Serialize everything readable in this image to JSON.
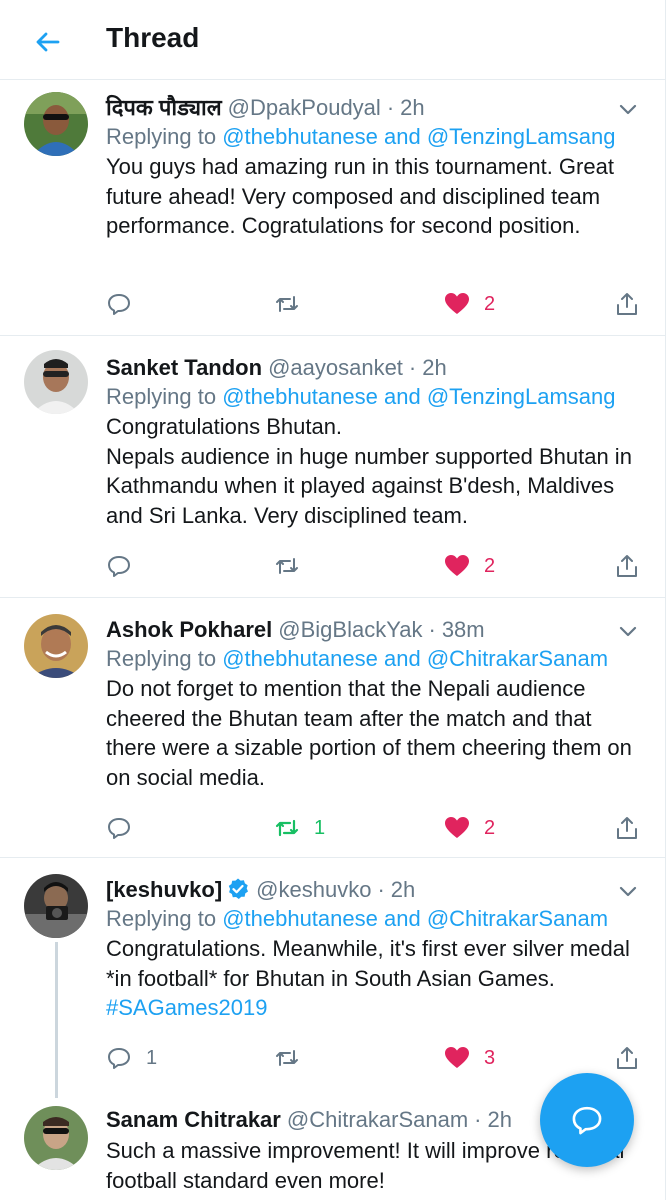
{
  "header": {
    "title": "Thread"
  },
  "tweets": [
    {
      "display_name": "दिपक पौड्याल",
      "handle": "@DpakPoudyal",
      "time": "2h",
      "replying_prefix": "Replying to ",
      "replying_to_1": "@thebhutanese",
      "replying_and": " and ",
      "replying_to_2": "@TenzingLamsang",
      "text": "You guys had amazing run in this tournament. Great future ahead! Very composed and disciplined team performance. Cogratulations for second position.",
      "reply_count": "",
      "retweet_count": "",
      "like_count": "2"
    },
    {
      "display_name": "Sanket Tandon",
      "handle": "@aayosanket",
      "time": "2h",
      "replying_prefix": "Replying to ",
      "replying_to_1": "@thebhutanese",
      "replying_and": " and ",
      "replying_to_2": "@TenzingLamsang",
      "text": "Congratulations Bhutan.\nNepals audience in huge number supported Bhutan in Kathmandu when it played against B'desh, Maldives and Sri Lanka. Very disciplined team.",
      "reply_count": "",
      "retweet_count": "",
      "like_count": "2"
    },
    {
      "display_name": "Ashok Pokharel",
      "handle": "@BigBlackYak",
      "time": "38m",
      "replying_prefix": "Replying to ",
      "replying_to_1": "@thebhutanese",
      "replying_and": " and ",
      "replying_to_2": "@ChitrakarSanam",
      "text": "Do not forget to mention that the Nepali audience cheered the Bhutan team after the match and that there were a sizable portion of them cheering them on on social media.",
      "reply_count": "",
      "retweet_count": "1",
      "like_count": "2"
    },
    {
      "display_name": "[keshuvko]",
      "handle": "@keshuvko",
      "time": "2h",
      "replying_prefix": "Replying to ",
      "replying_to_1": "@thebhutanese",
      "replying_and": " and ",
      "replying_to_2": "@ChitrakarSanam",
      "text_before_hashtag": "Congratulations. Meanwhile, it's first ever silver medal *in football* for Bhutan in South Asian Games. ",
      "hashtag": "#SAGames2019",
      "reply_count": "1",
      "retweet_count": "",
      "like_count": "3"
    },
    {
      "display_name": "Sanam Chitrakar",
      "handle": "@ChitrakarSanam",
      "time": "2h",
      "text": "Such a massive improvement! It will improve regional football standard even more!"
    }
  ],
  "colors": {
    "accent": "#1da1f2",
    "like": "#e0245e",
    "retweet": "#17bf63",
    "secondary_text": "#657786"
  },
  "icons": [
    "back-arrow-icon",
    "chevron-down-icon",
    "reply-icon",
    "retweet-icon",
    "heart-icon",
    "share-icon",
    "verified-badge-icon",
    "compose-reply-icon"
  ]
}
